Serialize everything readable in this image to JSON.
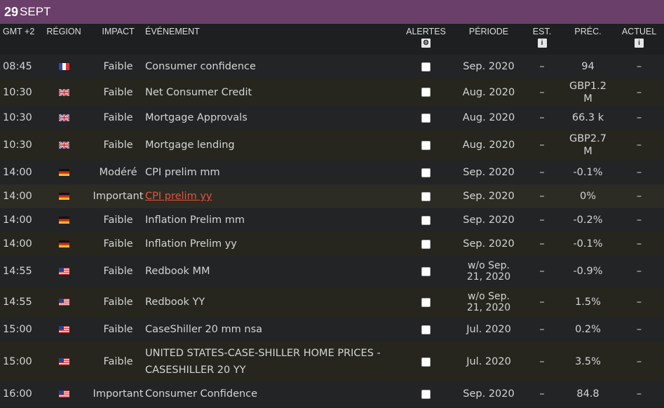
{
  "date_header": {
    "day": "29",
    "month": "SEPT"
  },
  "colors": {
    "header_bg": "#6a3f6a",
    "link": "#e2553d",
    "bg": "#202224"
  },
  "columns": {
    "time": "GMT +2",
    "region": "RÉGION",
    "impact": "IMPACT",
    "event": "ÉVÉNEMENT",
    "alerts": "ALERTES",
    "period": "PÉRIODE",
    "est": "EST.",
    "prec": "PRÉC.",
    "actual": "ACTUEL"
  },
  "rows": [
    {
      "time": "08:45",
      "flag": "fr",
      "impact": "Faible",
      "event": "Consumer confidence",
      "period": "Sep. 2020",
      "est": "–",
      "prec": "94",
      "actual": "–"
    },
    {
      "time": "10:30",
      "flag": "gb",
      "impact": "Faible",
      "event": "Net Consumer Credit",
      "period": "Aug. 2020",
      "est": "–",
      "prec": "GBP1.2 M",
      "actual": "–"
    },
    {
      "time": "10:30",
      "flag": "gb",
      "impact": "Faible",
      "event": "Mortgage Approvals",
      "period": "Aug. 2020",
      "est": "–",
      "prec": "66.3 k",
      "actual": "–"
    },
    {
      "time": "10:30",
      "flag": "gb",
      "impact": "Faible",
      "event": "Mortgage lending",
      "period": "Aug. 2020",
      "est": "–",
      "prec": "GBP2.7 M",
      "actual": "–"
    },
    {
      "time": "14:00",
      "flag": "de",
      "impact": "Modéré",
      "event": "CPI prelim mm",
      "period": "Sep. 2020",
      "est": "–",
      "prec": "-0.1%",
      "actual": "–"
    },
    {
      "time": "14:00",
      "flag": "de",
      "impact": "Important",
      "event": "CPI prelim yy",
      "period": "Sep. 2020",
      "est": "–",
      "prec": "0%",
      "actual": "–"
    },
    {
      "time": "14:00",
      "flag": "de",
      "impact": "Faible",
      "event": "Inflation Prelim mm",
      "period": "Sep. 2020",
      "est": "–",
      "prec": "-0.2%",
      "actual": "–"
    },
    {
      "time": "14:00",
      "flag": "de",
      "impact": "Faible",
      "event": "Inflation Prelim yy",
      "period": "Sep. 2020",
      "est": "–",
      "prec": "-0.1%",
      "actual": "–"
    },
    {
      "time": "14:55",
      "flag": "us",
      "impact": "Faible",
      "event": "Redbook MM",
      "period": "w/o Sep. 21, 2020",
      "est": "–",
      "prec": "-0.9%",
      "actual": "–"
    },
    {
      "time": "14:55",
      "flag": "us",
      "impact": "Faible",
      "event": "Redbook YY",
      "period": "w/o Sep. 21, 2020",
      "est": "–",
      "prec": "1.5%",
      "actual": "–"
    },
    {
      "time": "15:00",
      "flag": "us",
      "impact": "Faible",
      "event": "CaseShiller 20 mm nsa",
      "period": "Jul. 2020",
      "est": "–",
      "prec": "0.2%",
      "actual": "–"
    },
    {
      "time": "15:00",
      "flag": "us",
      "impact": "Faible",
      "event": "UNITED STATES-CASE-SHILLER HOME PRICES - CASESHILLER 20 YY",
      "period": "Jul. 2020",
      "est": "–",
      "prec": "3.5%",
      "actual": "–"
    },
    {
      "time": "16:00",
      "flag": "us",
      "impact": "Important",
      "event": "Consumer Confidence",
      "period": "Sep. 2020",
      "est": "–",
      "prec": "84.8",
      "actual": "–"
    }
  ]
}
